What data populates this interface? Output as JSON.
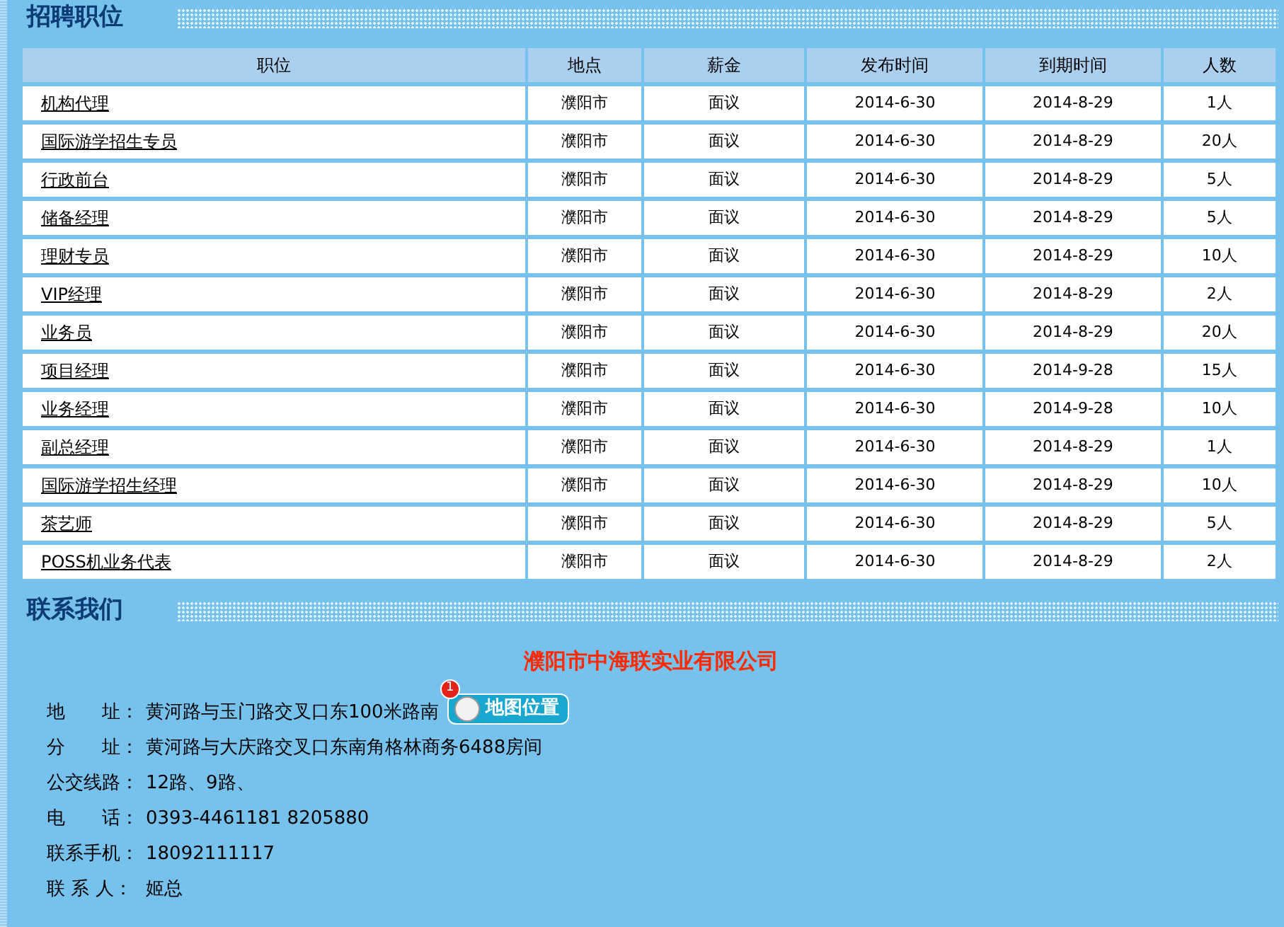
{
  "jobs_section": {
    "title": "招聘职位"
  },
  "table": {
    "columns": [
      "职位",
      "地点",
      "薪金",
      "发布时间",
      "到期时间",
      "人数"
    ],
    "rows": [
      [
        "机构代理",
        "濮阳市",
        "面议",
        "2014-6-30",
        "2014-8-29",
        "1人"
      ],
      [
        "国际游学招生专员",
        "濮阳市",
        "面议",
        "2014-6-30",
        "2014-8-29",
        "20人"
      ],
      [
        "行政前台",
        "濮阳市",
        "面议",
        "2014-6-30",
        "2014-8-29",
        "5人"
      ],
      [
        "储备经理",
        "濮阳市",
        "面议",
        "2014-6-30",
        "2014-8-29",
        "5人"
      ],
      [
        "理财专员",
        "濮阳市",
        "面议",
        "2014-6-30",
        "2014-8-29",
        "10人"
      ],
      [
        "VIP经理",
        "濮阳市",
        "面议",
        "2014-6-30",
        "2014-8-29",
        "2人"
      ],
      [
        "业务员",
        "濮阳市",
        "面议",
        "2014-6-30",
        "2014-8-29",
        "20人"
      ],
      [
        "项目经理",
        "濮阳市",
        "面议",
        "2014-6-30",
        "2014-9-28",
        "15人"
      ],
      [
        "业务经理",
        "濮阳市",
        "面议",
        "2014-6-30",
        "2014-9-28",
        "10人"
      ],
      [
        "副总经理",
        "濮阳市",
        "面议",
        "2014-6-30",
        "2014-8-29",
        "1人"
      ],
      [
        "国际游学招生经理",
        "濮阳市",
        "面议",
        "2014-6-30",
        "2014-8-29",
        "10人"
      ],
      [
        "茶艺师",
        "濮阳市",
        "面议",
        "2014-6-30",
        "2014-8-29",
        "5人"
      ],
      [
        "POSS机业务代表",
        "濮阳市",
        "面议",
        "2014-6-30",
        "2014-8-29",
        "2人"
      ]
    ]
  },
  "contact_section": {
    "title": "联系我们",
    "company": "濮阳市中海联实业有限公司",
    "lines": [
      {
        "label": "地　　址：",
        "value": "黄河路与玉门路交叉口东100米路南",
        "map_button": {
          "badge": "1",
          "label": "地图位置"
        }
      },
      {
        "label": "分　　址：",
        "value": "黄河路与大庆路交叉口东南角格林商务6488房间"
      },
      {
        "label": "公交线路：",
        "value": "12路、9路、"
      },
      {
        "label": "电　　话：",
        "value": "0393-4461181 8205880"
      },
      {
        "label": "联系手机：",
        "value": "18092111117"
      },
      {
        "label": "联 系 人：",
        "value": "姬总"
      }
    ]
  }
}
